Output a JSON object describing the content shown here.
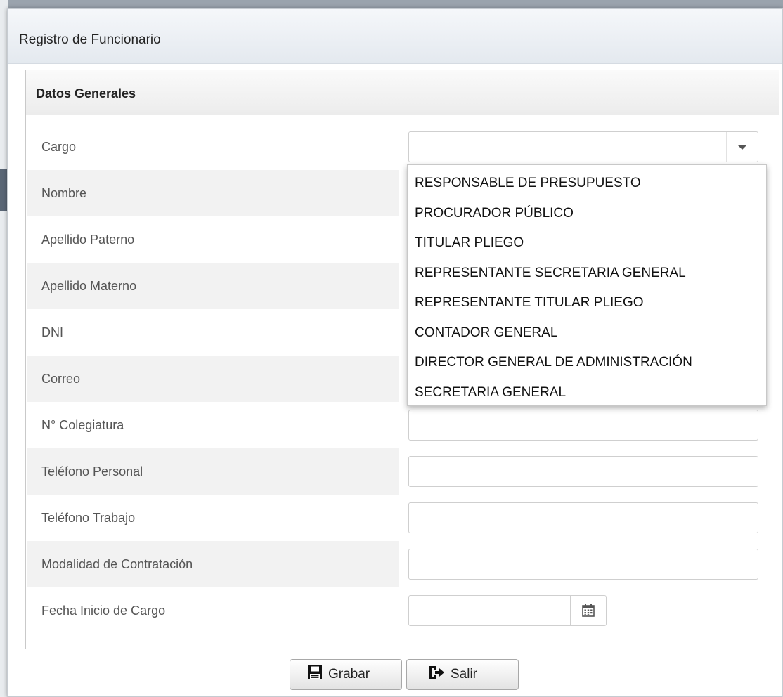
{
  "dialog": {
    "title": "Registro de Funcionario"
  },
  "panel": {
    "header": "Datos Generales"
  },
  "fields": [
    {
      "label": "Cargo",
      "type": "combo",
      "value": ""
    },
    {
      "label": "Nombre",
      "type": "text",
      "value": ""
    },
    {
      "label": "Apellido Paterno",
      "type": "text",
      "value": ""
    },
    {
      "label": "Apellido Materno",
      "type": "text",
      "value": ""
    },
    {
      "label": "DNI",
      "type": "text",
      "value": ""
    },
    {
      "label": "Correo",
      "type": "text",
      "value": ""
    },
    {
      "label": "N° Colegiatura",
      "type": "text",
      "value": ""
    },
    {
      "label": "Teléfono Personal",
      "type": "text",
      "value": ""
    },
    {
      "label": "Teléfono Trabajo",
      "type": "text",
      "value": ""
    },
    {
      "label": "Modalidad de Contratación",
      "type": "text",
      "value": ""
    },
    {
      "label": "Fecha Inicio de Cargo",
      "type": "date",
      "value": ""
    }
  ],
  "cargo_dropdown": {
    "options": [
      "RESPONSABLE DE PRESUPUESTO",
      "PROCURADOR PÚBLICO",
      "TITULAR PLIEGO",
      "REPRESENTANTE SECRETARIA GENERAL",
      "REPRESENTANTE TITULAR PLIEGO",
      "CONTADOR GENERAL",
      "DIRECTOR GENERAL DE ADMINISTRACIÓN",
      "SECRETARIA GENERAL"
    ]
  },
  "actions": {
    "save_label": "Grabar",
    "exit_label": "Salir"
  },
  "icons": {
    "save": "floppy-disk-icon",
    "exit": "sign-out-icon",
    "calendar": "calendar-icon",
    "dropdown": "chevron-down-icon"
  }
}
